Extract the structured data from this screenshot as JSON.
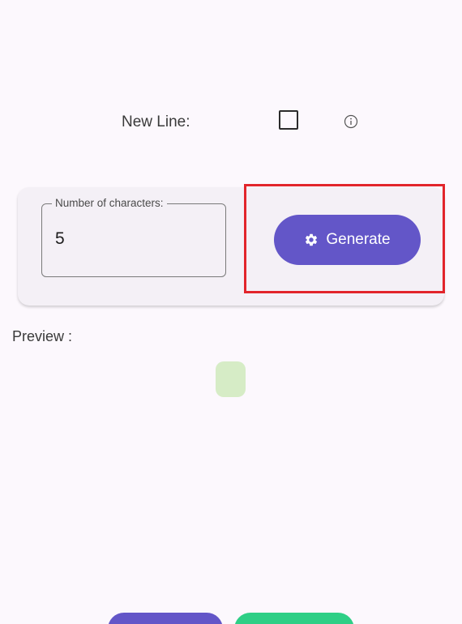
{
  "options": {
    "new_line_label": "New Line:",
    "new_line_checked": false,
    "info_icon": "info-icon"
  },
  "generator": {
    "field_label": "Number of characters:",
    "field_value": "5",
    "generate_label": "Generate",
    "generate_icon": "gear-icon"
  },
  "preview": {
    "label": "Preview :"
  },
  "colors": {
    "primary": "#6356c8",
    "secondary": "#2ecf86",
    "highlight": "#e2252b",
    "preview_chip": "#d6ecc6"
  }
}
